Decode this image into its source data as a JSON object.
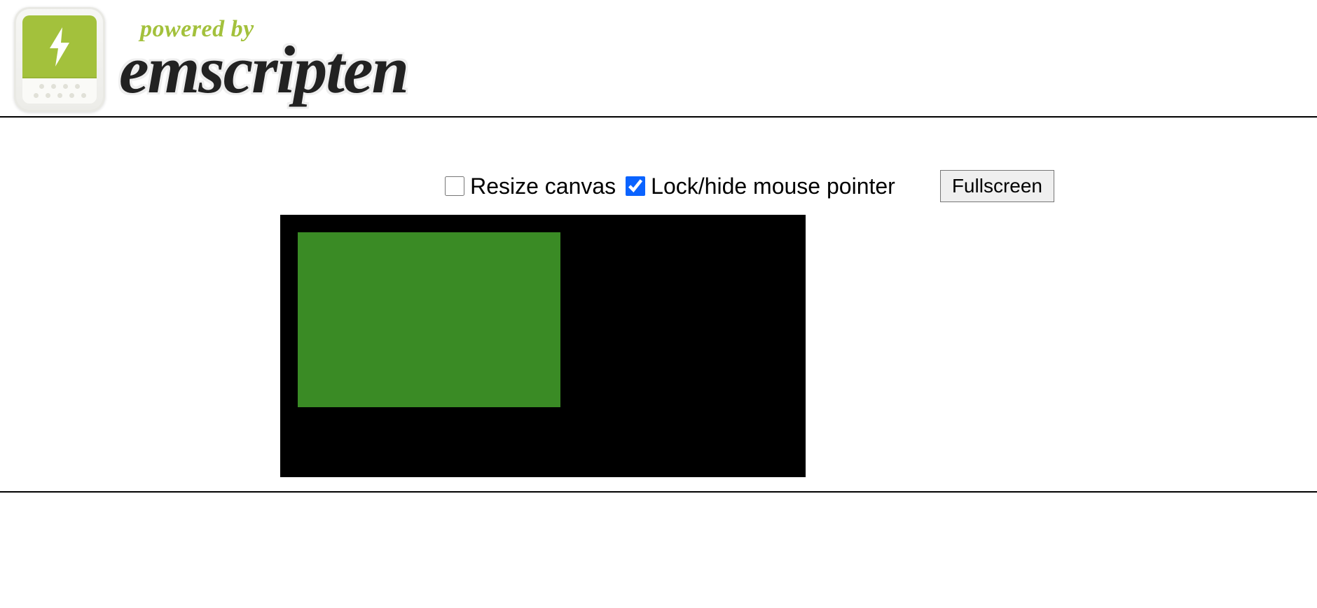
{
  "header": {
    "powered_by": "powered by",
    "brand": "emscripten"
  },
  "link_stub": " ",
  "controls": {
    "resize_label": "Resize canvas",
    "resize_checked": false,
    "lock_label": "Lock/hide mouse pointer",
    "lock_checked": true,
    "fullscreen_label": "Fullscreen"
  },
  "canvas": {
    "bg_color": "#000000",
    "rect_color": "#3a8b25"
  }
}
